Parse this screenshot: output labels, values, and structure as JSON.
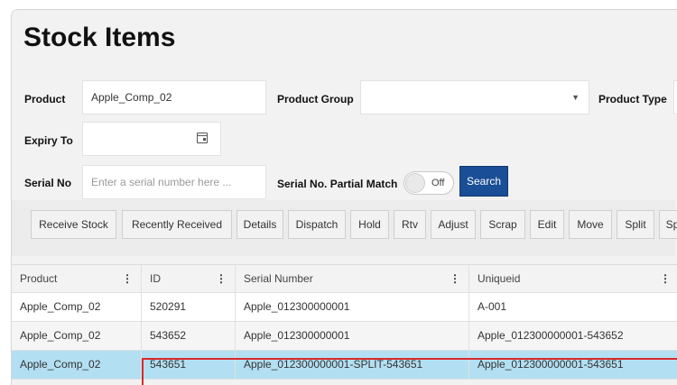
{
  "page": {
    "title": "Stock Items"
  },
  "filters": {
    "product": {
      "label": "Product",
      "value": "Apple_Comp_02"
    },
    "product_group": {
      "label": "Product Group",
      "value": ""
    },
    "product_type": {
      "label": "Product Type"
    },
    "expiry_to": {
      "label": "Expiry To",
      "value": ""
    },
    "serial_no": {
      "label": "Serial No",
      "placeholder": "Enter a serial number here ..."
    },
    "partial_match": {
      "label": "Serial No. Partial Match",
      "state": "Off"
    },
    "search_label": "Search"
  },
  "toolbar": {
    "buttons": [
      "Receive Stock",
      "Recently Received",
      "Details",
      "Dispatch",
      "Hold",
      "Rtv",
      "Adjust",
      "Scrap",
      "Edit",
      "Move",
      "Split",
      "Sp"
    ]
  },
  "table": {
    "columns": [
      "Product",
      "ID",
      "Serial Number",
      "Uniqueid"
    ],
    "rows": [
      [
        "Apple_Comp_02",
        "520291",
        "Apple_012300000001",
        "A-001"
      ],
      [
        "Apple_Comp_02",
        "543652",
        "Apple_012300000001",
        "Apple_012300000001-543652"
      ],
      [
        "Apple_Comp_02",
        "543651",
        "Apple_012300000001-SPLIT-543651",
        "Apple_012300000001-543651"
      ]
    ],
    "selected_row": 2
  },
  "colors": {
    "accent": "#1a4e96",
    "selected_row": "#b3dff2",
    "highlight_border": "#d62b2b"
  }
}
